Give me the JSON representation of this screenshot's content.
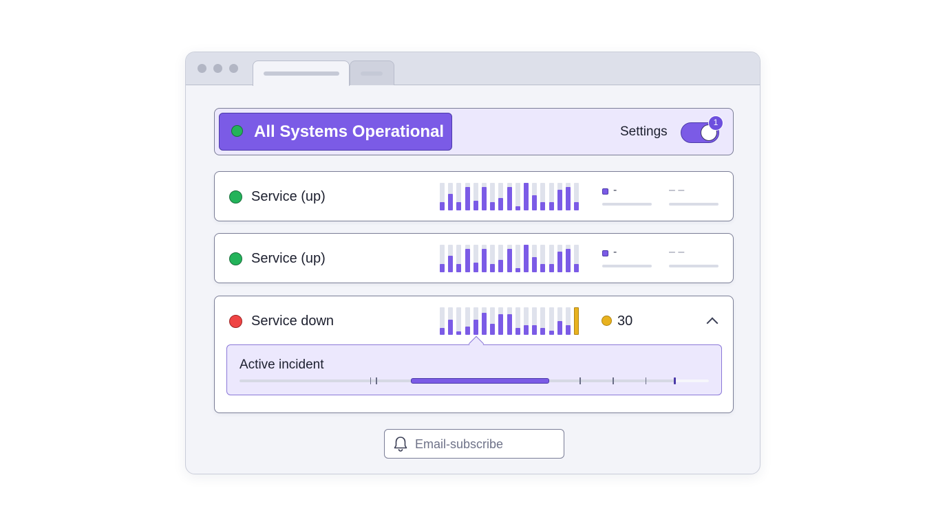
{
  "window": {
    "tabs": [
      {
        "state": "active"
      },
      {
        "state": "inactive"
      }
    ]
  },
  "banner": {
    "status_text": "All Systems Operational",
    "status_color": "#23b35a",
    "settings_label": "Settings",
    "toggle_on": true,
    "toggle_badge": "1"
  },
  "services": [
    {
      "name": "Service (up)",
      "status": "up",
      "status_color": "#23b35a",
      "uptime_bars": [
        0.3,
        0.6,
        0.3,
        0.85,
        0.35,
        0.85,
        0.3,
        0.45,
        0.85,
        0.15,
        1.0,
        0.55,
        0.3,
        0.3,
        0.75,
        0.85,
        0.3
      ],
      "metric_primary": "-",
      "metric_secondary": "– –"
    },
    {
      "name": "Service (up)",
      "status": "up",
      "status_color": "#23b35a",
      "uptime_bars": [
        0.3,
        0.6,
        0.3,
        0.85,
        0.35,
        0.85,
        0.3,
        0.45,
        0.85,
        0.15,
        1.0,
        0.55,
        0.3,
        0.3,
        0.75,
        0.85,
        0.3
      ],
      "metric_primary": "-",
      "metric_secondary": "– –"
    },
    {
      "name": "Service down",
      "status": "down",
      "status_color": "#ef4444",
      "uptime_bars": [
        0.25,
        0.55,
        0.12,
        0.3,
        0.55,
        0.8,
        0.4,
        0.75,
        0.75,
        0.25,
        0.35,
        0.35,
        0.25,
        0.15,
        0.5,
        0.35
      ],
      "alert_bar_color": "#e8b21f",
      "incident_count": "30",
      "expanded": true,
      "incident": {
        "title": "Active incident",
        "range_start": 0.365,
        "range_end": 0.66,
        "now_position": 0.925
      }
    }
  ],
  "subscribe": {
    "icon": "bell-icon",
    "label": "Email-subscribe"
  },
  "colors": {
    "accent": "#7b5be6",
    "banner_bg": "#ece8fd",
    "up": "#23b35a",
    "down": "#ef4444",
    "warning": "#e8b21f"
  }
}
